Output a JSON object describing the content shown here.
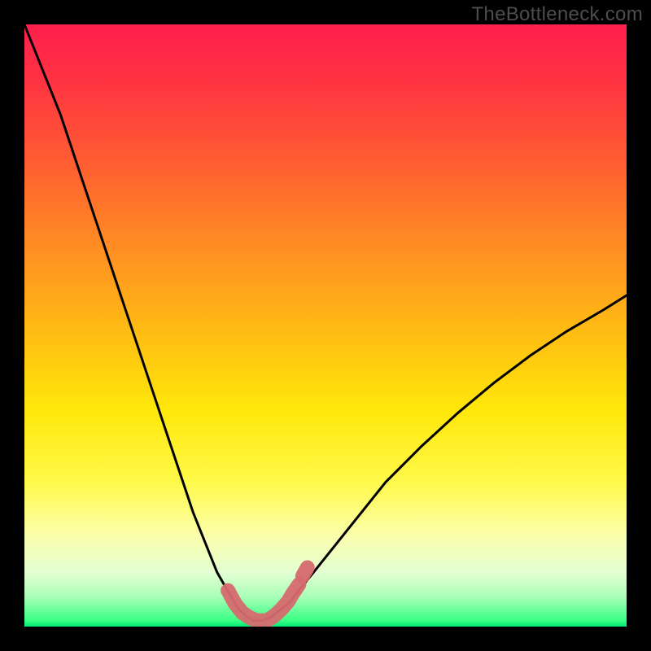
{
  "watermark": "TheBottleneck.com",
  "colors": {
    "frame": "#000000",
    "gradient_top": "#ff1f4d",
    "gradient_bottom": "#00e876",
    "curve": "#000000",
    "marker": "#d66a6f"
  },
  "chart_data": {
    "type": "line",
    "title": "",
    "xlabel": "",
    "ylabel": "",
    "xlim": [
      0,
      100
    ],
    "ylim": [
      0,
      100
    ],
    "grid": false,
    "series": [
      {
        "name": "bottleneck-curve",
        "x": [
          0,
          2,
          4,
          6,
          8,
          10,
          12,
          14,
          16,
          18,
          20,
          22,
          24,
          26,
          28,
          30,
          32,
          34,
          35.5,
          37,
          38,
          39.5,
          41,
          44,
          48,
          52,
          56,
          60,
          66,
          72,
          78,
          84,
          90,
          96,
          100
        ],
        "values": [
          100,
          95,
          90,
          85,
          79,
          73,
          67,
          61,
          55,
          49,
          43,
          37,
          31,
          25,
          19,
          14,
          9,
          5.5,
          3,
          1.6,
          1.0,
          1.0,
          1.6,
          4,
          9,
          14,
          19,
          24,
          30,
          35.5,
          40.5,
          45,
          49,
          52.5,
          55
        ]
      }
    ],
    "highlighted_region": {
      "name": "optimal-marker",
      "type": "scatter",
      "x": [
        33.8,
        35.0,
        36.2,
        37.4,
        38.6,
        39.4,
        40.2,
        41.4,
        42.6,
        43.8,
        44.5,
        45.6
      ],
      "values": [
        6.0,
        3.8,
        2.3,
        1.5,
        1.0,
        1.0,
        1.0,
        1.7,
        2.8,
        4.2,
        5.4,
        7.0
      ]
    }
  }
}
